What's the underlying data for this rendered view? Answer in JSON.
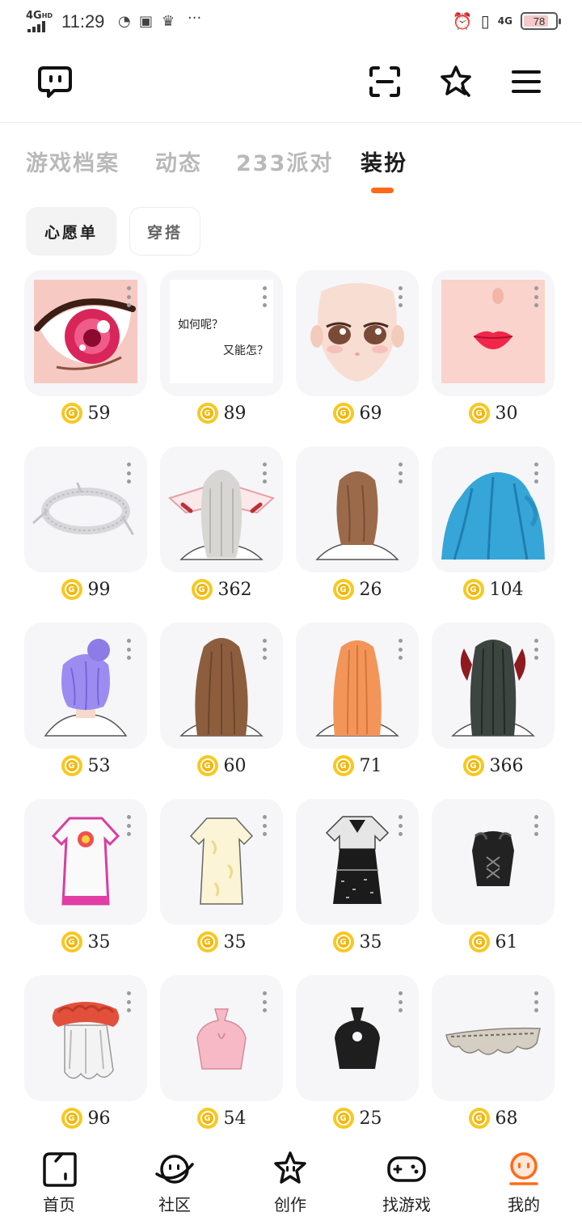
{
  "status_bar": {
    "network": "4G",
    "network_sup": "HD",
    "time": "11:29",
    "network_right": "4G",
    "battery": "78",
    "battery_level": 0.78
  },
  "header": {
    "icons": [
      "chat-bubble-icon",
      "scan-icon",
      "star-icon",
      "menu-icon"
    ]
  },
  "tabs": [
    {
      "label": "游戏档案",
      "active": false
    },
    {
      "label": "动态",
      "active": false
    },
    {
      "label": "233派对",
      "active": false
    },
    {
      "label": "装扮",
      "active": true
    }
  ],
  "chips": {
    "wishlist": "心愿单",
    "outfit": "穿搭"
  },
  "card_text": {
    "line1": "如何呢？",
    "line2": "又能怎？"
  },
  "items": [
    {
      "icon": "eye-icon",
      "price": "59"
    },
    {
      "icon": "text-card-icon",
      "price": "89"
    },
    {
      "icon": "face-icon",
      "price": "69"
    },
    {
      "icon": "lips-icon",
      "price": "30"
    },
    {
      "icon": "necklace-icon",
      "price": "99"
    },
    {
      "icon": "hair-silver-hat-icon",
      "price": "362"
    },
    {
      "icon": "hair-brown-short-icon",
      "price": "26"
    },
    {
      "icon": "hair-blue-icon",
      "price": "104"
    },
    {
      "icon": "hair-purple-bun-icon",
      "price": "53"
    },
    {
      "icon": "hair-brown-long-icon",
      "price": "60"
    },
    {
      "icon": "hair-orange-long-icon",
      "price": "71"
    },
    {
      "icon": "hair-black-twin-icon",
      "price": "366"
    },
    {
      "icon": "dress-white-pink-icon",
      "price": "35"
    },
    {
      "icon": "dress-cream-icon",
      "price": "35"
    },
    {
      "icon": "dress-black-sequin-icon",
      "price": "35"
    },
    {
      "icon": "corset-black-icon",
      "price": "61"
    },
    {
      "icon": "top-red-ruffle-icon",
      "price": "96"
    },
    {
      "icon": "top-pink-halter-icon",
      "price": "54"
    },
    {
      "icon": "top-black-halter-icon",
      "price": "25"
    },
    {
      "icon": "lace-trim-icon",
      "price": "68"
    }
  ],
  "bottom_nav": [
    {
      "label": "首页",
      "icon": "home-icon",
      "active": false
    },
    {
      "label": "社区",
      "icon": "community-planet-icon",
      "active": false
    },
    {
      "label": "创作",
      "icon": "create-star-icon",
      "active": false
    },
    {
      "label": "找游戏",
      "icon": "gamepad-icon",
      "active": false
    },
    {
      "label": "我的",
      "icon": "profile-icon",
      "active": true
    }
  ],
  "colors": {
    "accent": "#ff6a1a",
    "coin": "#f8c81e",
    "card_bg": "#f6f6f8",
    "tab_inactive": "#b9b9b9"
  }
}
